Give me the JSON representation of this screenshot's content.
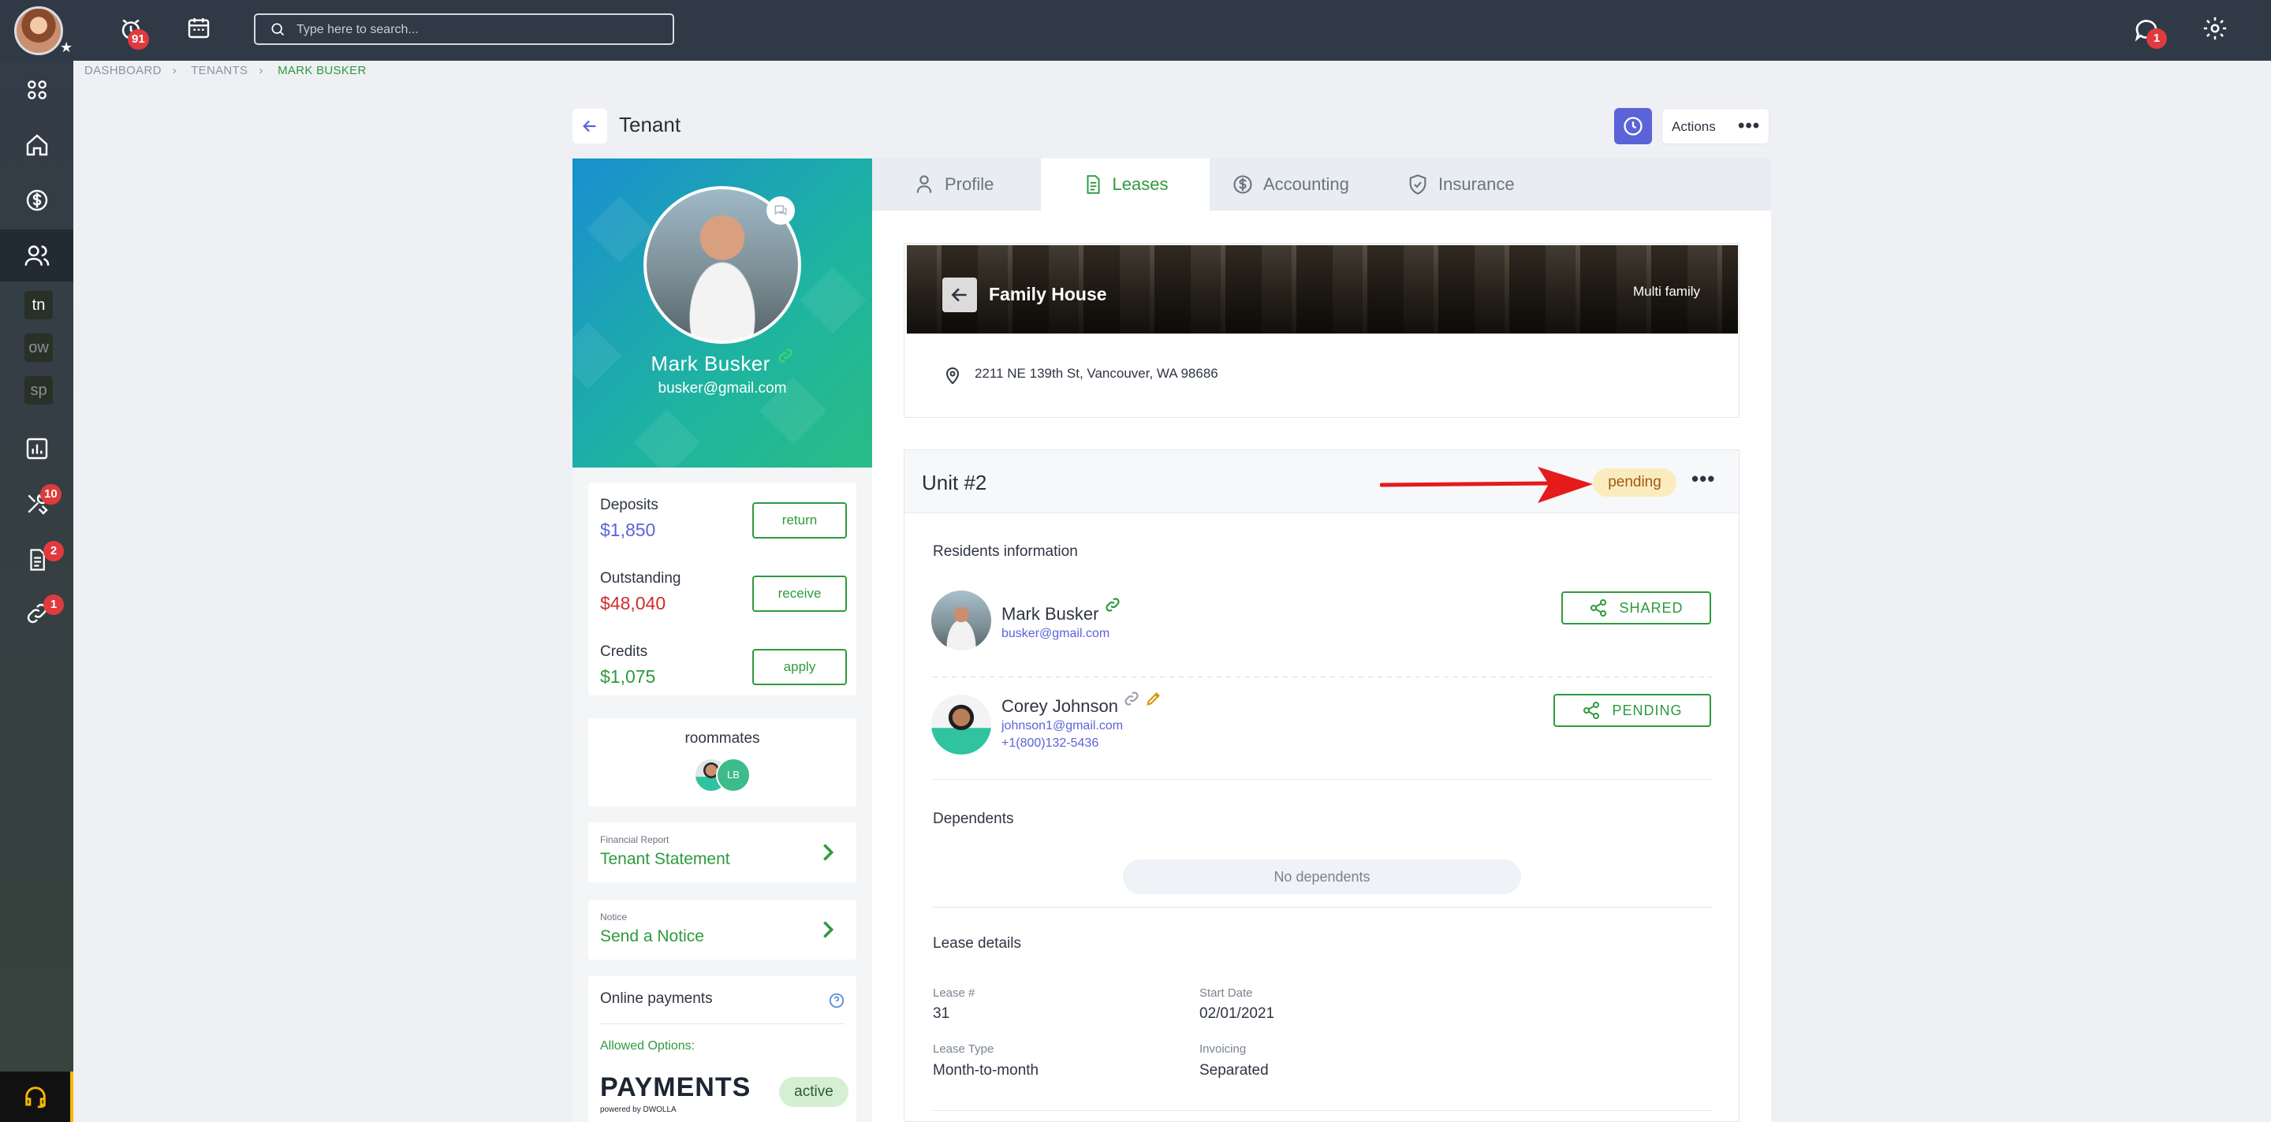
{
  "topbar": {
    "alerts_badge": "91",
    "search_placeholder": "Type here to search...",
    "messages_badge": "1"
  },
  "sidebar": {
    "items": [
      {
        "icon": "grid-icon"
      },
      {
        "icon": "home-icon"
      },
      {
        "icon": "dollar-icon"
      },
      {
        "icon": "people-icon"
      },
      {
        "label": "tn"
      },
      {
        "label": "ow"
      },
      {
        "label": "sp"
      },
      {
        "icon": "chart-icon"
      },
      {
        "icon": "tools-icon",
        "badge": "10"
      },
      {
        "icon": "document-icon",
        "badge": "2"
      },
      {
        "icon": "link-icon",
        "badge": "1"
      }
    ],
    "support_icon": "headset-icon"
  },
  "breadcrumb": [
    "DASHBOARD",
    "TENANTS",
    "MARK BUSKER"
  ],
  "header": {
    "title": "Tenant",
    "actions_label": "Actions"
  },
  "profile": {
    "name": "Mark Busker",
    "email": "busker@gmail.com"
  },
  "finances": [
    {
      "label": "Deposits",
      "amount": "$1,850",
      "button": "return",
      "color": "#5b63d8"
    },
    {
      "label": "Outstanding",
      "amount": "$48,040",
      "button": "receive",
      "color": "#d22b2b"
    },
    {
      "label": "Credits",
      "amount": "$1,075",
      "button": "apply",
      "color": "#2e9a3e"
    }
  ],
  "roommates": {
    "title": "roommates",
    "second_initials": "LB"
  },
  "links": [
    {
      "small": "Financial Report",
      "main": "Tenant Statement"
    },
    {
      "small": "Notice",
      "main": "Send a Notice"
    }
  ],
  "online_payments": {
    "title": "Online payments",
    "allowed": "Allowed Options:",
    "logo_text": "PAYMENTS",
    "powered": "powered by DWOLLA",
    "status": "active"
  },
  "tabs": [
    {
      "label": "Profile",
      "icon": "person-icon"
    },
    {
      "label": "Leases",
      "icon": "document-icon"
    },
    {
      "label": "Accounting",
      "icon": "dollar-icon"
    },
    {
      "label": "Insurance",
      "icon": "shield-icon"
    }
  ],
  "property": {
    "name": "Family House",
    "type": "Multi family",
    "address": "2211 NE 139th St, Vancouver, WA 98686"
  },
  "unit": {
    "title": "Unit #2",
    "status": "pending",
    "residents_title": "Residents information",
    "residents": [
      {
        "name": "Mark Busker",
        "email": "busker@gmail.com",
        "phone": "",
        "button": "SHARED"
      },
      {
        "name": "Corey Johnson",
        "email": "johnson1@gmail.com",
        "phone": "+1(800)132-5436",
        "button": "PENDING"
      }
    ],
    "dependents_title": "Dependents",
    "no_dependents": "No dependents",
    "lease_title": "Lease details",
    "lease_fields": [
      {
        "label": "Lease #",
        "value": "31"
      },
      {
        "label": "Start Date",
        "value": "02/01/2021"
      },
      {
        "label": "Lease Type",
        "value": "Month-to-month"
      },
      {
        "label": "Invoicing",
        "value": "Separated"
      }
    ]
  },
  "colors": {
    "accent": "#2e9a3e",
    "purple": "#5b63d8",
    "pending_bg": "#fbecbf",
    "annotation_arrow": "#e31b1b"
  }
}
